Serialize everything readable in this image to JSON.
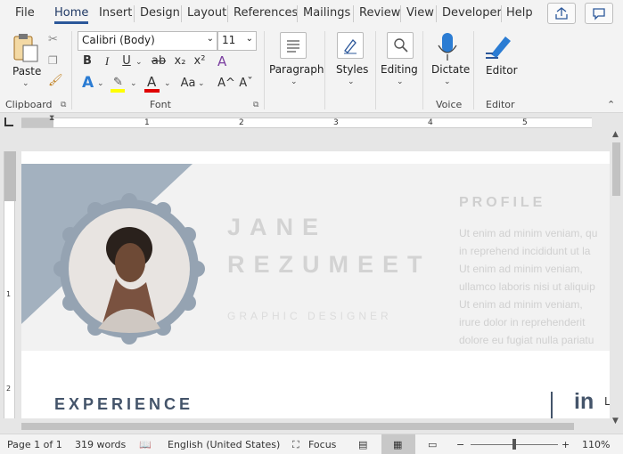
{
  "menu": {
    "tabs": [
      "File",
      "Home",
      "Insert",
      "Design",
      "Layout",
      "References",
      "Mailings",
      "Review",
      "View",
      "Developer",
      "Help"
    ],
    "active": "Home"
  },
  "ribbon": {
    "clipboard": {
      "paste": "Paste",
      "group": "Clipboard"
    },
    "font": {
      "name": "Calibri (Body)",
      "size": "11",
      "bold": "B",
      "italic": "I",
      "underline": "U",
      "strike": "ab",
      "sub": "x₂",
      "sup": "x²",
      "case": "Aa",
      "grow": "A^",
      "shrink": "Aˇ",
      "group": "Font"
    },
    "paragraph": {
      "label": "Paragraph"
    },
    "styles": {
      "label": "Styles"
    },
    "editing": {
      "label": "Editing"
    },
    "voice": {
      "dictate": "Dictate",
      "group": "Voice"
    },
    "editor": {
      "label": "Editor",
      "group": "Editor"
    }
  },
  "ruler": {
    "numbers": [
      "1",
      "2",
      "3",
      "4",
      "5"
    ]
  },
  "document": {
    "first_name": "JANE",
    "last_name": "REZUMEET",
    "subtitle": "GRAPHIC DESIGNER",
    "profile_title": "PROFILE",
    "profile_lines": [
      "Ut enim ad minim veniam, qu",
      "in reprehend incididunt ut la",
      "Ut enim ad minim veniam,",
      "ullamco laboris nisi ut aliquip",
      "Ut enim ad minim veniam,",
      "irure dolor in reprehenderit",
      "dolore eu fugiat nulla pariatu"
    ],
    "experience": "EXPERIENCE",
    "linkedin": "in",
    "linkedin_tail": "L"
  },
  "status": {
    "page": "Page 1 of 1",
    "words": "319 words",
    "language": "English (United States)",
    "focus": "Focus",
    "zoom": "110%"
  },
  "colors": {
    "accent": "#2b579a",
    "banner_shape": "#a3b1bf",
    "heading": "#44546a",
    "highlight": "#ffff00",
    "font_color": "#e00000"
  }
}
